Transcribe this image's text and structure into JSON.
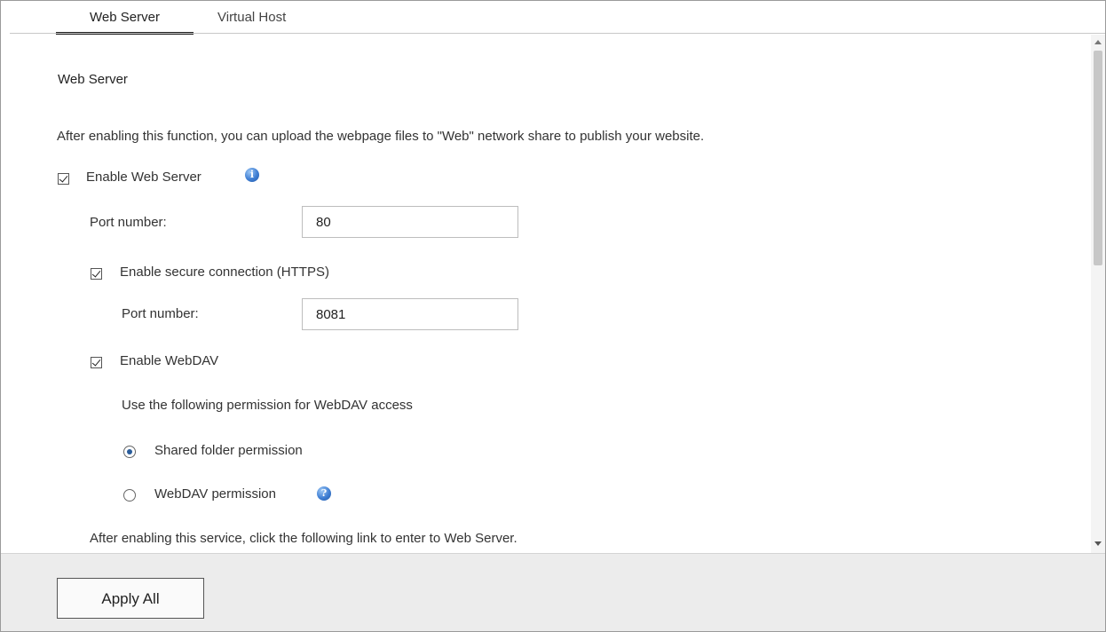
{
  "tabs": [
    {
      "label": "Web Server",
      "active": true
    },
    {
      "label": "Virtual Host",
      "active": false
    }
  ],
  "section": {
    "title": "Web Server",
    "description": "After enabling this function, you can upload the webpage files to \"Web\" network share to publish your website."
  },
  "enable_web_server": {
    "label": "Enable Web Server",
    "checked": true,
    "info_icon": "info-icon"
  },
  "port": {
    "label": "Port number:",
    "value": "80"
  },
  "https": {
    "label": "Enable secure connection (HTTPS)",
    "checked": true,
    "port_label": "Port number:",
    "port_value": "8081"
  },
  "webdav": {
    "label": "Enable WebDAV",
    "checked": true,
    "permission_prompt": "Use the following permission for WebDAV access",
    "options": [
      {
        "label": "Shared folder permission",
        "selected": true
      },
      {
        "label": "WebDAV permission",
        "selected": false,
        "help_icon": "help-icon"
      }
    ]
  },
  "link_note": "After enabling this service, click the following link to enter to Web Server.",
  "footer": {
    "apply_label": "Apply All"
  },
  "colors": {
    "accent": "#2a5c9a",
    "footer_bg": "#ececec",
    "info_icon": "#3f7ed3"
  }
}
